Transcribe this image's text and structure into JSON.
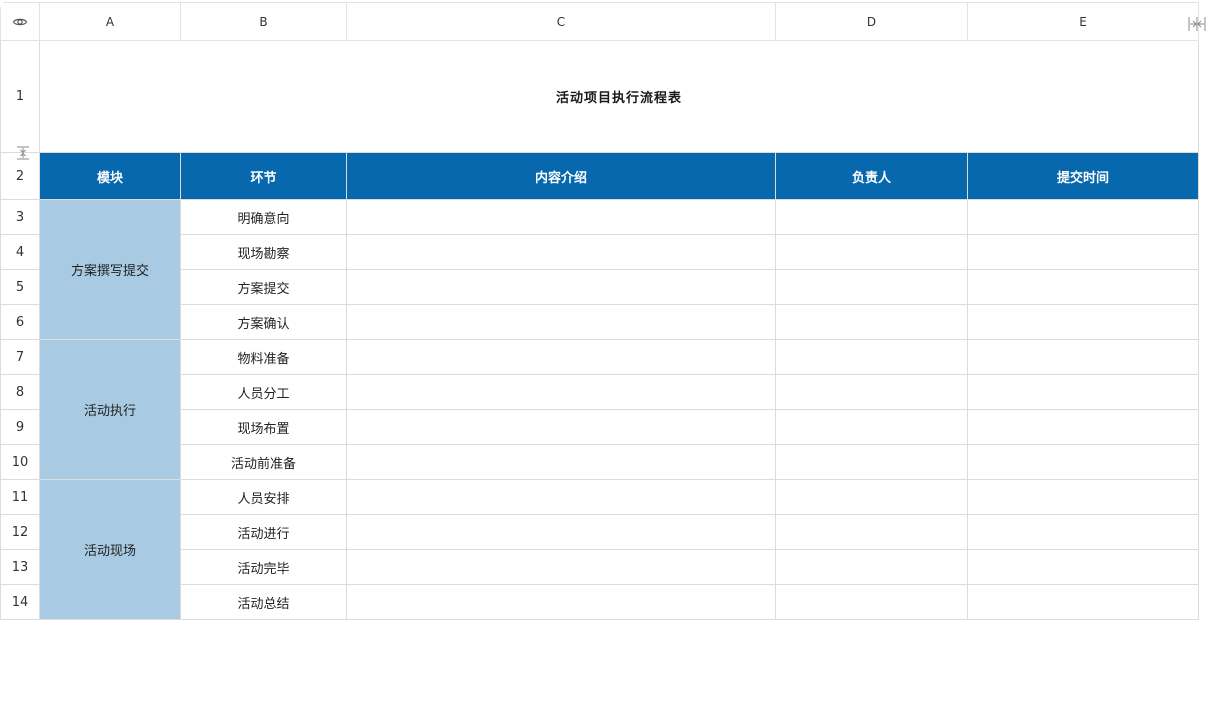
{
  "columns": [
    "A",
    "B",
    "C",
    "D",
    "E"
  ],
  "rows": [
    "1",
    "2",
    "3",
    "4",
    "5",
    "6",
    "7",
    "8",
    "9",
    "10",
    "11",
    "12",
    "13",
    "14"
  ],
  "title": "活动项目执行流程表",
  "headers": {
    "module": "模块",
    "step": "环节",
    "content": "内容介绍",
    "owner": "负责人",
    "submit_time": "提交时间"
  },
  "modules": [
    "方案撰写提交",
    "活动执行",
    "活动现场"
  ],
  "steps": [
    "明确意向",
    "现场勘察",
    "方案提交",
    "方案确认",
    "物料准备",
    "人员分工",
    "现场布置",
    "活动前准备",
    "人员安排",
    "活动进行",
    "活动完毕",
    "活动总结"
  ],
  "icons": {
    "corner": "eye-icon",
    "row_freeze": "freeze-rows-handle-icon",
    "col_freeze": "freeze-columns-handle-icon"
  },
  "colors": {
    "header_bg": "#0868ae",
    "module_bg": "#a8cbe3"
  }
}
